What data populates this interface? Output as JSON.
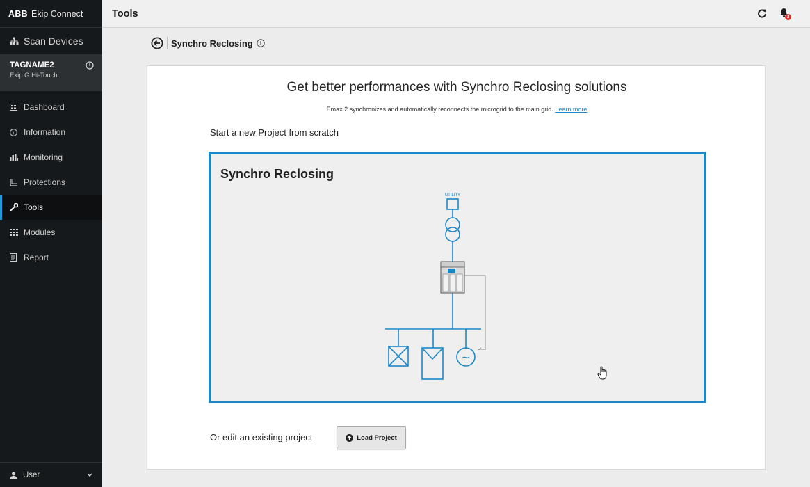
{
  "app": {
    "brand_logo": "ABB",
    "brand_name": "Ekip Connect"
  },
  "sidebar": {
    "scan_label": "Scan Devices",
    "device": {
      "tag": "TAGNAME2",
      "model": "Ekip G Hi-Touch"
    },
    "items": [
      {
        "label": "Dashboard",
        "icon": "dashboard-icon",
        "active": false
      },
      {
        "label": "Information",
        "icon": "info-icon",
        "active": false
      },
      {
        "label": "Monitoring",
        "icon": "bar-chart-icon",
        "active": false
      },
      {
        "label": "Protections",
        "icon": "protection-curve-icon",
        "active": false
      },
      {
        "label": "Tools",
        "icon": "wrench-icon",
        "active": true
      },
      {
        "label": "Modules",
        "icon": "modules-grid-icon",
        "active": false
      },
      {
        "label": "Report",
        "icon": "document-icon",
        "active": false
      }
    ],
    "user_label": "User"
  },
  "header": {
    "title": "Tools",
    "notification_count": "3"
  },
  "subhead": {
    "label": "Synchro Reclosing"
  },
  "main": {
    "headline": "Get better performances with Synchro Reclosing solutions",
    "description": "Emax 2 synchronizes and automatically reconnects the microgrid to the main grid.",
    "learn_more": "Learn more",
    "start_label": "Start a new Project from scratch",
    "project_title": "Synchro Reclosing",
    "diagram_utility_label": "UTILITY",
    "generator_symbol": "~",
    "edit_label": "Or edit an existing project",
    "load_button": "Load Project"
  },
  "colors": {
    "accent": "#1a88c8",
    "sidebar_bg": "#16191b",
    "badge": "#e12a2a"
  }
}
